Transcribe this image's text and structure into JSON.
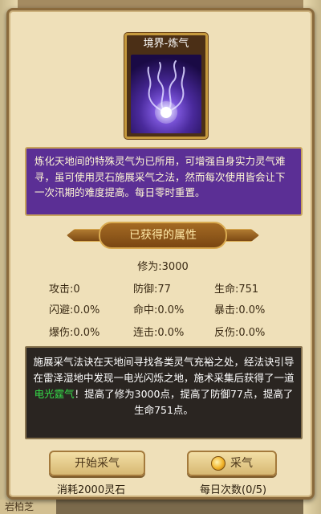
{
  "background": {
    "top_text": "",
    "bottom_label": "岩柏芝"
  },
  "card": {
    "title": "境界-炼气",
    "art_icon": "qi-flame-art"
  },
  "description": "炼化天地间的特殊灵气为已所用，可增强自身实力灵气难寻，虽可使用灵石施展采气之法，然而每次使用皆会让下一次汛期的难度提高。每日零时重置。",
  "attributes": {
    "header": "已获得的属性",
    "cultivation": "修为:3000",
    "stats": [
      [
        "攻击:0",
        "防御:77",
        "生命:751"
      ],
      [
        "闪避:0.0%",
        "命中:0.0%",
        "暴击:0.0%"
      ],
      [
        "爆伤:0.0%",
        "连击:0.0%",
        "反伤:0.0%"
      ]
    ]
  },
  "result": {
    "part1": "施展采气法诀在天地间寻找各类灵气充裕之处，经法诀引导在雷泽湿地中发现一电光闪烁之地，施术采集后获得了一道",
    "highlight": "电光霆气",
    "part2": "！提高了修为3000点，提高了防御77点，提高了生命751点。"
  },
  "actions": {
    "start_label": "开始采气",
    "start_cost": "消耗2000灵石",
    "collect_label": "采气",
    "collect_count": "每日次数(0/5)"
  },
  "colors": {
    "description_bg": "#5b2f95",
    "highlight": "#35e04a",
    "panel_bg": "#efe0b9"
  }
}
